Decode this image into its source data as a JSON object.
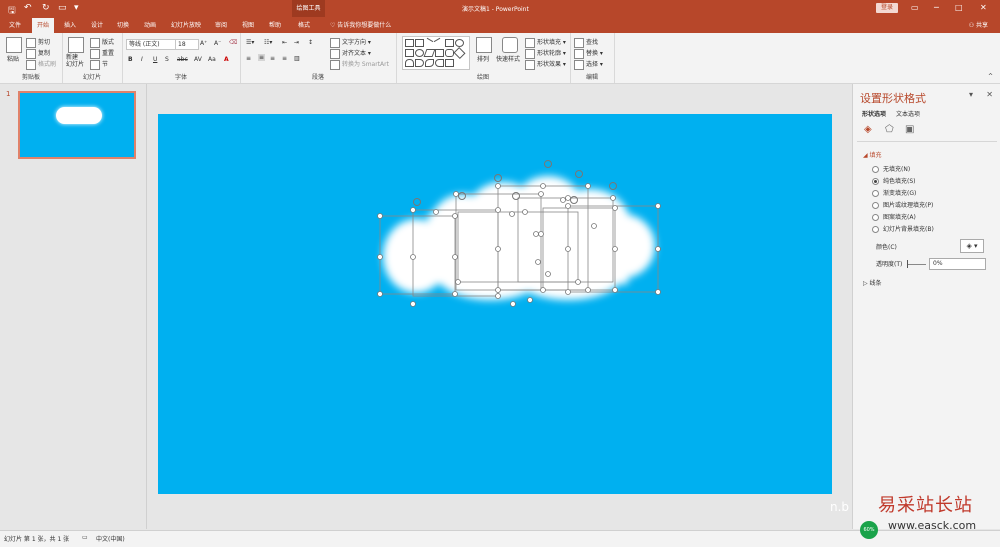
{
  "titlebar": {
    "drawing_tools": "绘图工具",
    "title": "演示文稿1 - PowerPoint",
    "login": "登录",
    "restore": "▭",
    "minimize": "─",
    "maximize": "□",
    "close": "✕"
  },
  "tabs": [
    "文件",
    "开始",
    "插入",
    "设计",
    "切换",
    "动画",
    "幻灯片放映",
    "审阅",
    "视图",
    "帮助",
    "格式"
  ],
  "active_tab": "开始",
  "tellme": "告诉我你想要做什么",
  "share": "共享",
  "ribbon": {
    "clipboard": {
      "paste": "粘贴",
      "cut": "剪切",
      "copy": "复制",
      "format_painter": "格式刷",
      "label": "剪贴板"
    },
    "slides": {
      "new_slide": "新建\n幻灯片",
      "layout": "版式",
      "reset": "重置",
      "section": "节",
      "label": "幻灯片"
    },
    "font": {
      "font_name": "等线 (正文)",
      "font_size": "18",
      "bold": "B",
      "italic": "I",
      "underline": "U",
      "strike": "S",
      "shadow": "abc",
      "spacing": "AV",
      "case": "Aa",
      "color": "A",
      "label": "字体"
    },
    "paragraph": {
      "text_direction": "文字方向",
      "align_text": "对齐文本",
      "smartart": "转换为 SmartArt",
      "label": "段落"
    },
    "drawing": {
      "arrange": "排列",
      "quick_styles": "快速样式",
      "shape_fill": "形状填充",
      "shape_outline": "形状轮廓",
      "shape_effects": "形状效果",
      "label": "绘图"
    },
    "editing": {
      "find": "查找",
      "replace": "替换",
      "select": "选择",
      "label": "编辑"
    }
  },
  "thumbnail": {
    "number": "1"
  },
  "format_pane": {
    "title": "设置形状格式",
    "tabs": [
      "形状选项",
      "文本选项"
    ],
    "section_fill": "填充",
    "fill_options": [
      "无填充(N)",
      "纯色填充(S)",
      "渐变填充(G)",
      "图片或纹理填充(P)",
      "图案填充(A)",
      "幻灯片背景填充(B)"
    ],
    "selected_fill": 1,
    "color_label": "颜色(C)",
    "transparency_label": "透明度(T)",
    "transparency_value": "0%",
    "section_line": "线条"
  },
  "statusbar": {
    "slide_info": "幻灯片 第 1 张，共 1 张",
    "language": "中文(中国)"
  },
  "watermark": {
    "cn": "易采站长站",
    "url": "www.easck.com",
    "badge": "60%",
    "partial": "n.b"
  },
  "colors": {
    "accent": "#b7472a",
    "slide_bg": "#00b0f0",
    "cloud": "#ffffff"
  }
}
